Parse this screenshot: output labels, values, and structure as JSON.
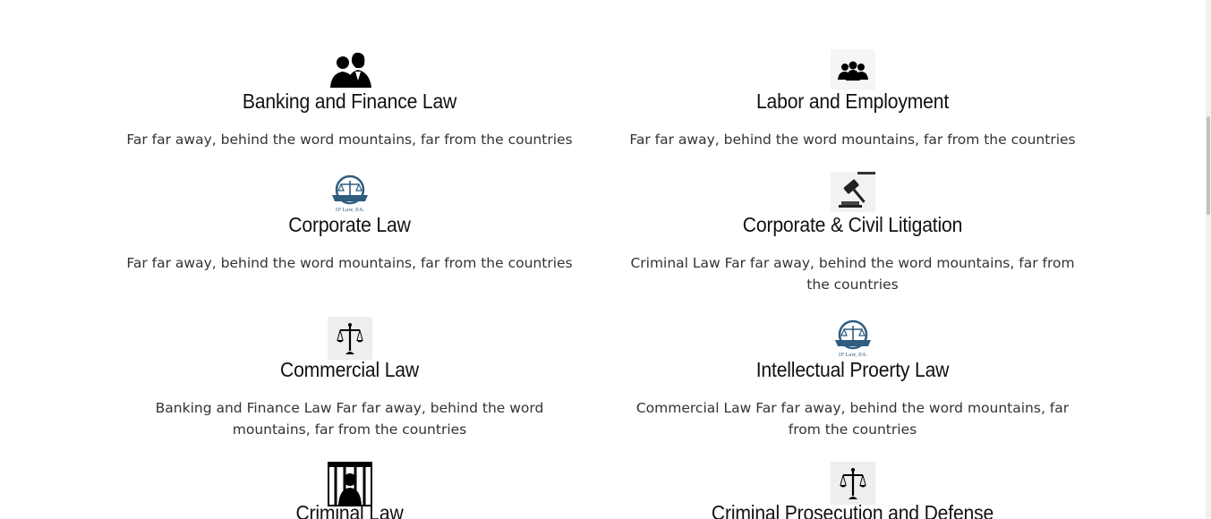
{
  "services": [
    {
      "icon": "people-silhouette-icon",
      "title": "Banking and Finance Law",
      "description": "Far far away, behind the word mountains, far from the countries"
    },
    {
      "icon": "group-people-icon",
      "title": "Labor and Employment",
      "description": "Far far away, behind the word mountains, far from the countries"
    },
    {
      "icon": "law-scales-logo-icon",
      "logo_text": "IP Law, P.A.",
      "title": "Corporate Law",
      "description": "Far far away, behind the word mountains, far from the countries"
    },
    {
      "icon": "gavel-icon",
      "title": "Corporate & Civil Litigation",
      "description": "Criminal Law Far far away, behind the word mountains, far from the countries"
    },
    {
      "icon": "scales-of-justice-icon",
      "title": "Commercial Law",
      "description": "Banking and Finance Law Far far away, behind the word mountains, far from the countries"
    },
    {
      "icon": "law-scales-logo-icon",
      "logo_text": "IP Law, P.A.",
      "title": "Intellectual Proerty Law",
      "description": "Commercial Law Far far away, behind the word mountains, far from the countries"
    },
    {
      "icon": "prisoner-behind-bars-icon",
      "title": "Criminal Law",
      "description": ""
    },
    {
      "icon": "scales-of-justice-icon",
      "title": "Criminal Prosecution and Defense",
      "description": ""
    }
  ]
}
